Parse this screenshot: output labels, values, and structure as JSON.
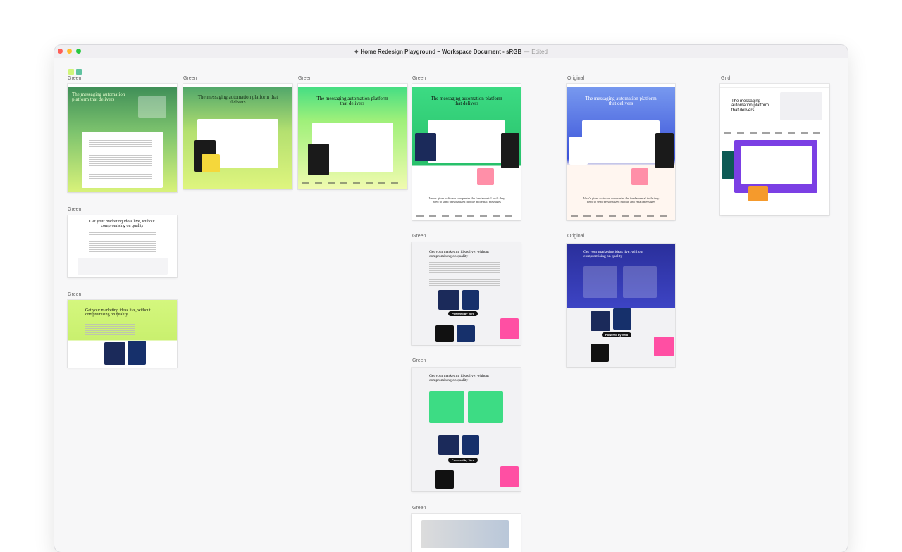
{
  "window": {
    "title": "Home Redesign Playground – Workspace Document - sRGB",
    "separator": "—",
    "status": "Edited",
    "doc_icon": "document-icon",
    "traffic_lights": {
      "close": "#fe5f57",
      "minimize": "#febc2e",
      "zoom": "#28c840"
    }
  },
  "colors": {
    "green_light": "#cff57a",
    "green_mid": "#38b36a",
    "green_bright": "#3ddc84",
    "blue": "#3b52d9",
    "navy": "#2a2f9b",
    "purple": "#7b3fe4",
    "pink": "#ff4fa3",
    "yellow": "#f5d73b"
  },
  "artboards": {
    "a1": {
      "label": "Green",
      "heading": "The messaging automation platform that delivers"
    },
    "a2": {
      "label": "Green",
      "heading": "The messaging automation platform that delivers"
    },
    "a3": {
      "label": "Green",
      "heading": "The messaging automation platform that delivers"
    },
    "a4": {
      "label": "Green",
      "heading": "The messaging automation platform that delivers",
      "sub": "Vero's gives software companies the fundamental tools they need to send personalized mobile and email messages"
    },
    "a5": {
      "label": "Original",
      "heading": "The messaging automation platform that delivers",
      "sub": "Vero's gives software companies the fundamental tools they need to send personalized mobile and email messages"
    },
    "a6": {
      "label": "Grid",
      "heading": "The messaging automation platform that delivers"
    },
    "b1": {
      "label": "Green",
      "heading": "Get your marketing ideas live, without compromising on quality"
    },
    "b2": {
      "label": "Green",
      "heading": "Get your marketing ideas live, without compromising on quality"
    },
    "c1": {
      "label": "Green",
      "heading": "Get your marketing ideas live, without compromising on quality",
      "badge": "Powered by Vero"
    },
    "c2": {
      "label": "Original",
      "heading": "Get your marketing ideas live, without compromising on quality",
      "badge": "Powered by Vero"
    },
    "d1": {
      "label": "Green",
      "heading": "Get your marketing ideas live, without compromising on quality",
      "badge": "Powered by Vero"
    },
    "e1": {
      "label": "Green"
    }
  }
}
